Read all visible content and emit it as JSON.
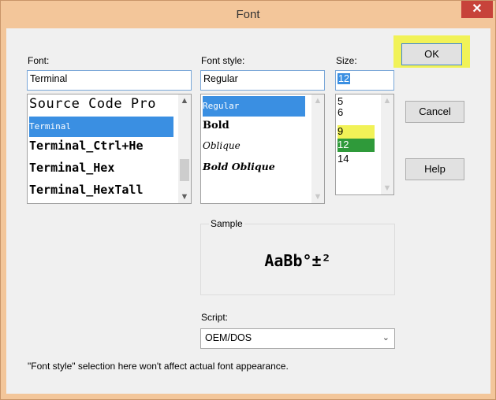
{
  "window": {
    "title": "Font",
    "close_glyph": "✕"
  },
  "font": {
    "label": "Font:",
    "value": "Terminal",
    "items": [
      "Source Code Pro",
      "Terminal",
      "Terminal_Ctrl+He",
      "Terminal_Hex",
      "Terminal_HexTall"
    ],
    "selected": "Terminal"
  },
  "style": {
    "label": "Font style:",
    "value": "Regular",
    "items": [
      "Regular",
      "Bold",
      "Oblique",
      "Bold Oblique"
    ],
    "selected": "Regular"
  },
  "size": {
    "label": "Size:",
    "value": "12",
    "items": [
      "5",
      "6",
      "9",
      "12",
      "14"
    ],
    "selected": "12",
    "highlight_color": "#f1f257",
    "selected_color": "#2f9a3a"
  },
  "buttons": {
    "ok": "OK",
    "cancel": "Cancel",
    "help": "Help"
  },
  "sample": {
    "label": "Sample",
    "text": "AaBb°±²"
  },
  "script": {
    "label": "Script:",
    "value": "OEM/DOS"
  },
  "note": "\"Font style\" selection here won't affect actual font appearance.",
  "icons": {
    "scroll_up": "▲",
    "scroll_down": "▼",
    "dropdown": "⌄"
  },
  "colors": {
    "title_bar": "#f3c69a",
    "close_button": "#c7433a",
    "selection": "#3a8fe2",
    "ok_highlight": "#f1f257"
  }
}
